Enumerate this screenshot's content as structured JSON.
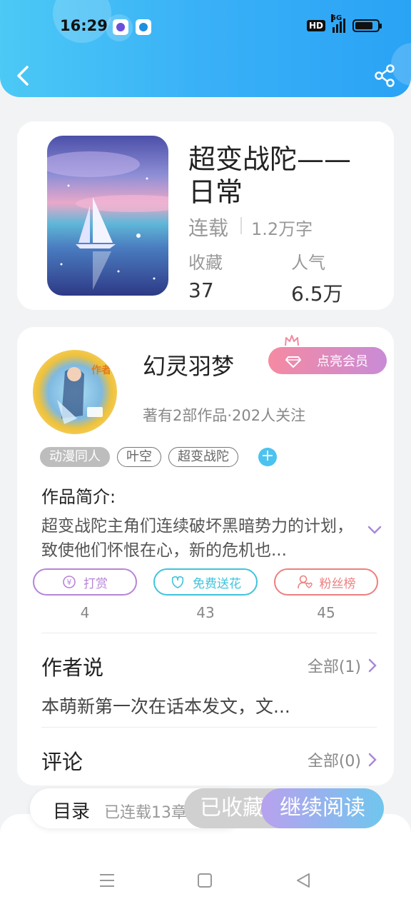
{
  "status_bar": {
    "time": "16:29",
    "network_badge": "HD",
    "network_type": "5G",
    "battery_level": 0.8
  },
  "header": {
    "back_icon": "chevron-left-icon",
    "share_icon": "share-icon",
    "background_color": "#39b0f7"
  },
  "book": {
    "title": "超变战陀——日常",
    "status": "连载",
    "word_count": "1.2万字",
    "stats": [
      {
        "label": "收藏",
        "value": "37"
      },
      {
        "label": "人气",
        "value": "6.5万"
      }
    ]
  },
  "author": {
    "avatar_badge": "作者",
    "name": "幻灵羽梦",
    "vip_button": "点亮会员",
    "meta": "著有2部作品·202人关注",
    "tags": [
      "动漫同人",
      "叶空",
      "超变战陀"
    ],
    "add_tag_icon": "plus-icon"
  },
  "intro": {
    "title": "作品简介:",
    "text": "超变战陀主角们连续破坏黑暗势力的计划，致使他们怀恨在心，新的危机也..."
  },
  "actions": [
    {
      "label": "打赏",
      "icon": "coin-icon",
      "count": "4",
      "color": "#b784d8"
    },
    {
      "label": "免费送花",
      "icon": "flower-icon",
      "count": "43",
      "color": "#3fc4dc"
    },
    {
      "label": "粉丝榜",
      "icon": "fans-icon",
      "count": "45",
      "color": "#ee7f7f"
    }
  ],
  "author_say": {
    "title": "作者说",
    "all_label": "全部(1)",
    "text": "本萌新第一次在话本发文，文..."
  },
  "comments": {
    "title": "评论",
    "all_label": "全部(0)"
  },
  "bottom_bar": {
    "toc_label": "目录",
    "toc_status": "已连载13章",
    "favorite_label": "已收藏",
    "read_label": "继续阅读"
  },
  "system_nav": {
    "menu_icon": "menu-icon",
    "home_icon": "home-icon",
    "back_icon": "back-triangle-icon"
  }
}
